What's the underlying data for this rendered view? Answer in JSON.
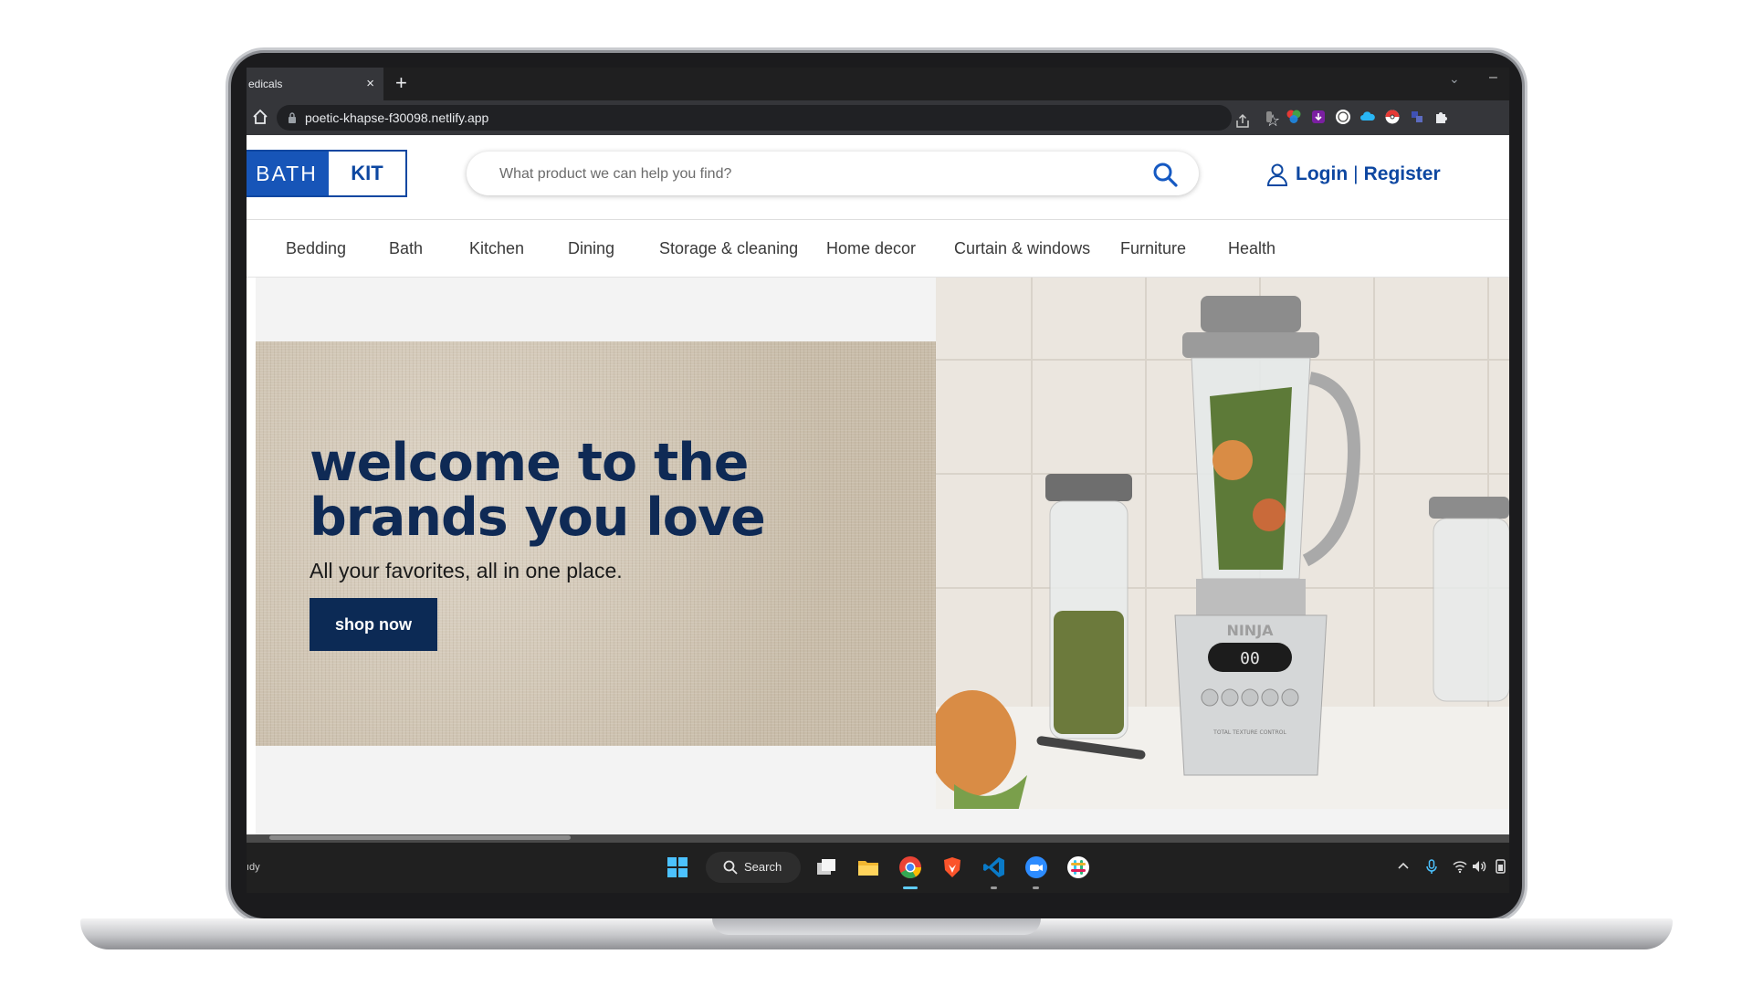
{
  "browser": {
    "tab_title": "edicals",
    "tab_close": "×",
    "new_tab": "+",
    "url": "poetic-khapse-f30098.netlify.app",
    "tab_list_icon": "chevron-down-icon",
    "minimize_symbol": "–",
    "star_symbol": "☆"
  },
  "site": {
    "logo_left": "BATH",
    "logo_right": "KIT",
    "search_placeholder": "What product we can help you find?",
    "login": "Login",
    "separator": "|",
    "register": "Register",
    "brand_color": "#0d47a1"
  },
  "nav": {
    "items": [
      "Bedding",
      "Bath",
      "Kitchen",
      "Dining",
      "Storage & cleaning",
      "Home decor",
      "Curtain & windows",
      "Furniture",
      "Health"
    ]
  },
  "hero": {
    "title": "welcome to the brands you love",
    "subtitle": "All your favorites, all in one place.",
    "cta": "shop now",
    "cta_color": "#0c2a55",
    "appliance_display": "00",
    "appliance_brand": "NINJA",
    "appliance_caption": "TOTAL TEXTURE CONTROL"
  },
  "taskbar": {
    "edge_text": "ıdy",
    "search_label": "Search"
  }
}
